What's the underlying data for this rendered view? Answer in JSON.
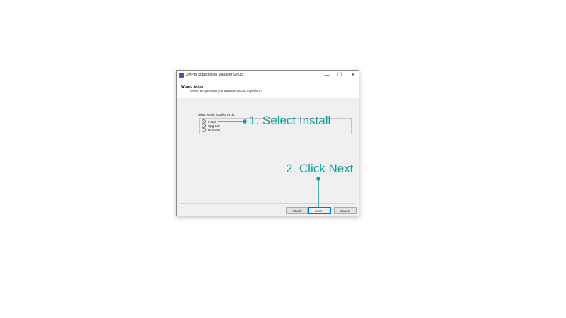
{
  "window": {
    "title": "XMPro Subscription Manager Setup",
    "controls": {
      "minimize": "—",
      "maximize": "☐",
      "close": "✕"
    }
  },
  "header": {
    "title": "Wizard Action",
    "subtitle": "Select an operation you want the wizard to perform."
  },
  "main": {
    "question": "What would you like to do:",
    "options": [
      {
        "label": "Install",
        "selected": true
      },
      {
        "label": "Upgrade",
        "selected": false
      },
      {
        "label": "Uninstall",
        "selected": false
      }
    ]
  },
  "footer": {
    "back_label": "< Back",
    "next_label": "Next >",
    "cancel_label": "Cancel"
  },
  "annotations": {
    "step1": "1. Select Install",
    "step2": "2. Click Next",
    "accent_color": "#13a098"
  }
}
